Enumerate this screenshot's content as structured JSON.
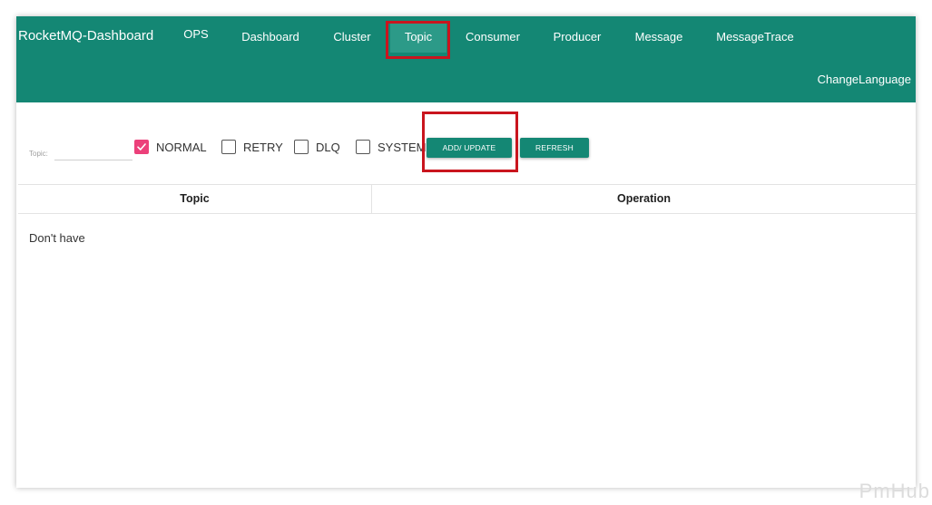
{
  "header": {
    "brand": "RocketMQ-Dashboard",
    "nav": [
      {
        "label": "OPS"
      },
      {
        "label": "Dashboard"
      },
      {
        "label": "Cluster"
      },
      {
        "label": "Topic"
      },
      {
        "label": "Consumer"
      },
      {
        "label": "Producer"
      },
      {
        "label": "Message"
      },
      {
        "label": "MessageTrace"
      }
    ],
    "active_nav": "Topic",
    "change_language": "ChangeLanguage"
  },
  "filter": {
    "topic_label": "Topic:",
    "topic_value": "",
    "checkboxes": [
      {
        "label": "NORMAL",
        "checked": true
      },
      {
        "label": "RETRY",
        "checked": false
      },
      {
        "label": "DLQ",
        "checked": false
      },
      {
        "label": "SYSTEM",
        "checked": false
      }
    ],
    "add_update_label": "ADD/ UPDATE",
    "refresh_label": "REFRESH"
  },
  "table": {
    "columns": [
      "Topic",
      "Operation"
    ],
    "empty_text": "Don't have"
  },
  "watermark": "PmHub",
  "colors": {
    "primary": "#148774",
    "checkbox_checked": "#ec407a",
    "highlight": "#c9151e"
  },
  "icons": {
    "check": "check-icon"
  }
}
